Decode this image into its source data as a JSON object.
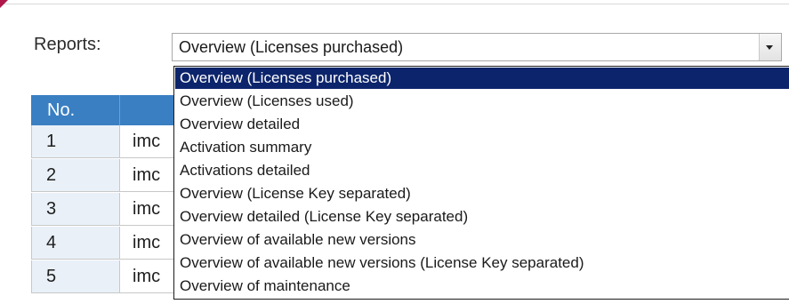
{
  "reports": {
    "label": "Reports:",
    "selected": "Overview (Licenses purchased)",
    "options": [
      "Overview (Licenses purchased)",
      "Overview (Licenses used)",
      "Overview detailed",
      "Activation summary",
      "Activations detailed",
      "Overview (License Key separated)",
      "Overview detailed (License Key separated)",
      "Overview of available new versions",
      "Overview of available new versions (License Key separated)",
      "Overview of maintenance"
    ]
  },
  "table": {
    "header_no": "No.",
    "rows": [
      {
        "no": "1",
        "name": "imc"
      },
      {
        "no": "2",
        "name": "imc"
      },
      {
        "no": "3",
        "name": "imc"
      },
      {
        "no": "4",
        "name": "imc"
      },
      {
        "no": "5",
        "name": "imc"
      }
    ]
  },
  "colors": {
    "header_blue": "#3a7fc2",
    "selection_navy": "#0c246b"
  }
}
